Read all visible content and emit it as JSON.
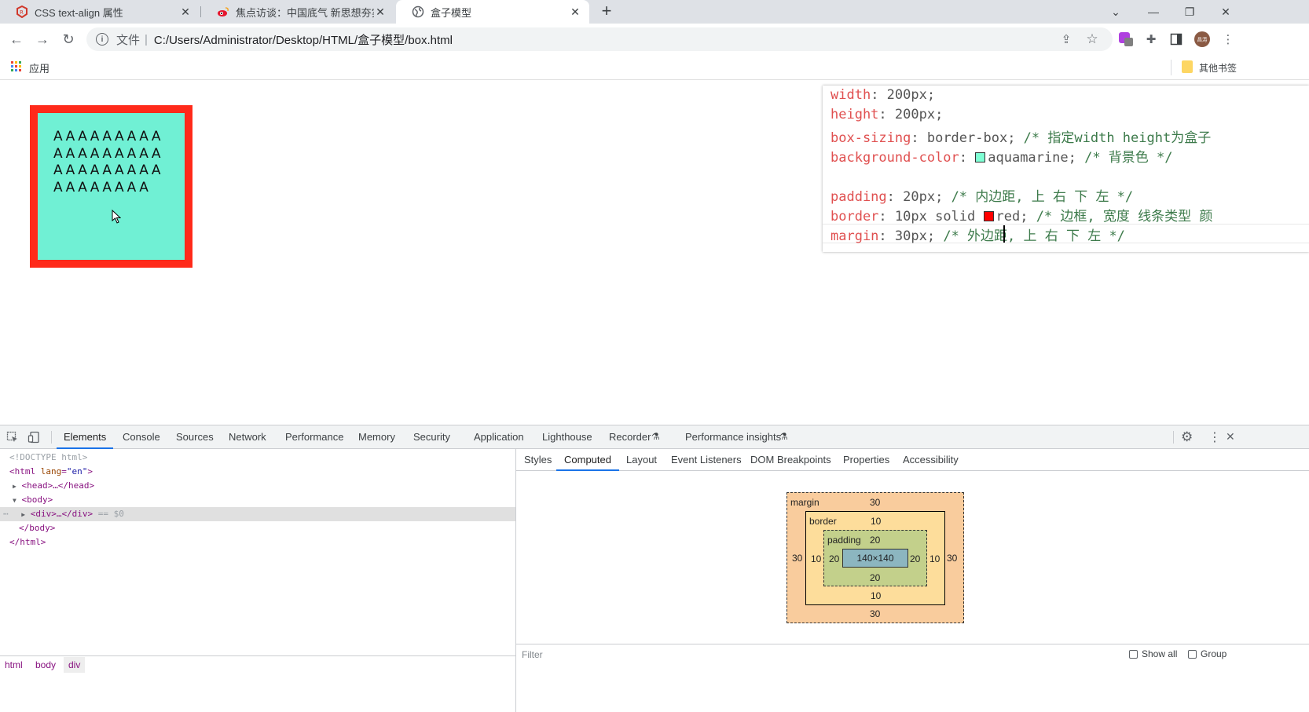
{
  "browser": {
    "tabs": [
      {
        "title": "CSS text-align 属性",
        "icon": "runoob-icon"
      },
      {
        "title": "焦点访谈：中国底气 新思想夯实",
        "icon": "weibo-icon"
      },
      {
        "title": "盒子模型",
        "icon": "globe-icon"
      }
    ],
    "new_tab": "+",
    "address": {
      "scheme": "文件",
      "separator": "|",
      "url": "C:/Users/Administrator/Desktop/HTML/盒子模型/box.html"
    },
    "bookmarks": {
      "apps": "应用",
      "other": "其他书签"
    }
  },
  "page": {
    "box_text": "AAAAAAAAAAAAAAAAAAAAAAAAAAAAAAAAAAA"
  },
  "code": {
    "lines": [
      {
        "prop": "width",
        "val": " 200px;",
        "cmt": ""
      },
      {
        "prop": "height",
        "val": " 200px;",
        "cmt": ""
      },
      {
        "prop": "box-sizing",
        "val": " border-box;",
        "cmt": " /* 指定width height为盒子"
      },
      {
        "prop": "background-color",
        "val": "aquamarine;",
        "cmt": " /* 背景色 */",
        "swatch": "#7fffd4"
      },
      {
        "prop": "",
        "val": "",
        "cmt": ""
      },
      {
        "prop": "padding",
        "val": " 20px;",
        "cmt": " /* 内边距, 上 右 下 左 */"
      },
      {
        "prop": "border",
        "val": " 10px solid ",
        "val2": "red;",
        "cmt": " /* 边框, 宽度 线条类型 颜",
        "swatch": "#ff0000"
      },
      {
        "prop": "margin",
        "val": " 30px;",
        "cmt": " /* 外边距, 上 右 下 左 */"
      }
    ]
  },
  "devtools": {
    "tabs": [
      "Elements",
      "Console",
      "Sources",
      "Network",
      "Performance",
      "Memory",
      "Security",
      "Application",
      "Lighthouse",
      "Recorder",
      "Performance insights"
    ],
    "elements": [
      {
        "text": "<!DOCTYPE html>"
      },
      {
        "tag": "html",
        "attr": "lang",
        "val": "\"en\""
      },
      {
        "text": "<head>…</head>"
      },
      {
        "text": "<body>"
      },
      {
        "text": "<div>…</div>",
        "suffix": " == $0"
      },
      {
        "text": "</body>"
      },
      {
        "text": "</html>"
      }
    ],
    "side_tabs": [
      "Styles",
      "Computed",
      "Layout",
      "Event Listeners",
      "DOM Breakpoints",
      "Properties",
      "Accessibility"
    ],
    "box_model": {
      "margin_label": "margin",
      "margin": {
        "top": "30",
        "right": "30",
        "bottom": "30",
        "left": "30"
      },
      "border_label": "border",
      "border": {
        "top": "10",
        "right": "10",
        "bottom": "10",
        "left": "10"
      },
      "padding_label": "padding",
      "padding": {
        "top": "20",
        "right": "20",
        "bottom": "20",
        "left": "20"
      },
      "content": "140×140"
    },
    "filter_placeholder": "Filter",
    "show_all": "Show all",
    "group": "Group",
    "breadcrumbs": [
      "html",
      "body",
      "div"
    ]
  }
}
